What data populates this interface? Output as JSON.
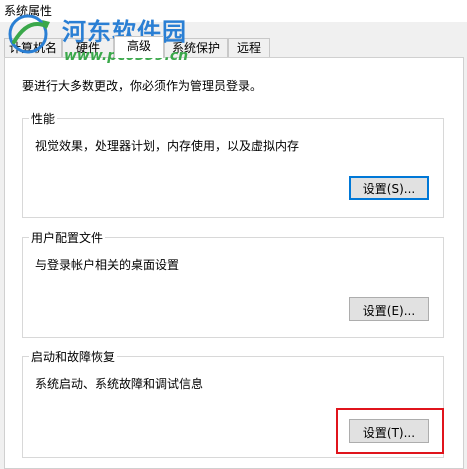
{
  "window": {
    "title": "系统属性"
  },
  "watermark": {
    "name": "河东软件园",
    "url": "www.pc0359.cn"
  },
  "tabs": [
    {
      "label": "计算机名"
    },
    {
      "label": "硬件"
    },
    {
      "label": "高级"
    },
    {
      "label": "系统保护"
    },
    {
      "label": "远程"
    }
  ],
  "notice": "要进行大多数更改，你必须作为管理员登录。",
  "sections": {
    "performance": {
      "title": "性能",
      "desc": "视觉效果，处理器计划，内存使用，以及虚拟内存",
      "button": "设置(S)..."
    },
    "profile": {
      "title": "用户配置文件",
      "desc": "与登录帐户相关的桌面设置",
      "button": "设置(E)..."
    },
    "startup": {
      "title": "启动和故障恢复",
      "desc": "系统启动、系统故障和调试信息",
      "button": "设置(T)..."
    }
  },
  "colors": {
    "accent": "#0078d7",
    "highlight": "#e0141c",
    "watermark_name": "#2a7fd4",
    "watermark_url": "#3aa84a"
  }
}
